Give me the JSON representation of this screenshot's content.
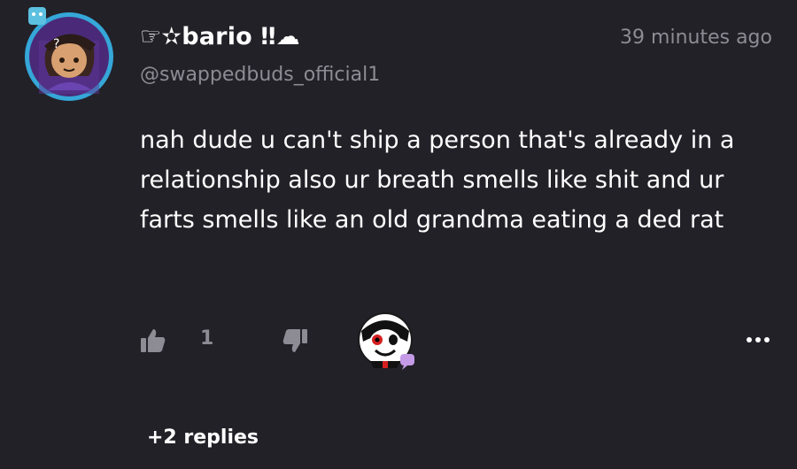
{
  "comment": {
    "username": "☞✫bario ‼☁",
    "handle": "@swappedbuds_official1",
    "timestamp": "39 minutes ago",
    "text": "nah dude u can't ship a person that's already in a relationship also ur breath smells like shit and ur farts smells like an old grandma eating a ded rat"
  },
  "actions": {
    "like_icon": "thumbs-up-icon",
    "like_count": "1",
    "dislike_icon": "thumbs-down-icon",
    "more_icon": "more-options-icon"
  },
  "replies": {
    "label": "+2 replies"
  },
  "colors": {
    "background": "#222128",
    "muted_text": "#8d8b93",
    "avatar_ring": "#35a7d8",
    "reaction_badge": "#c59ae6"
  }
}
